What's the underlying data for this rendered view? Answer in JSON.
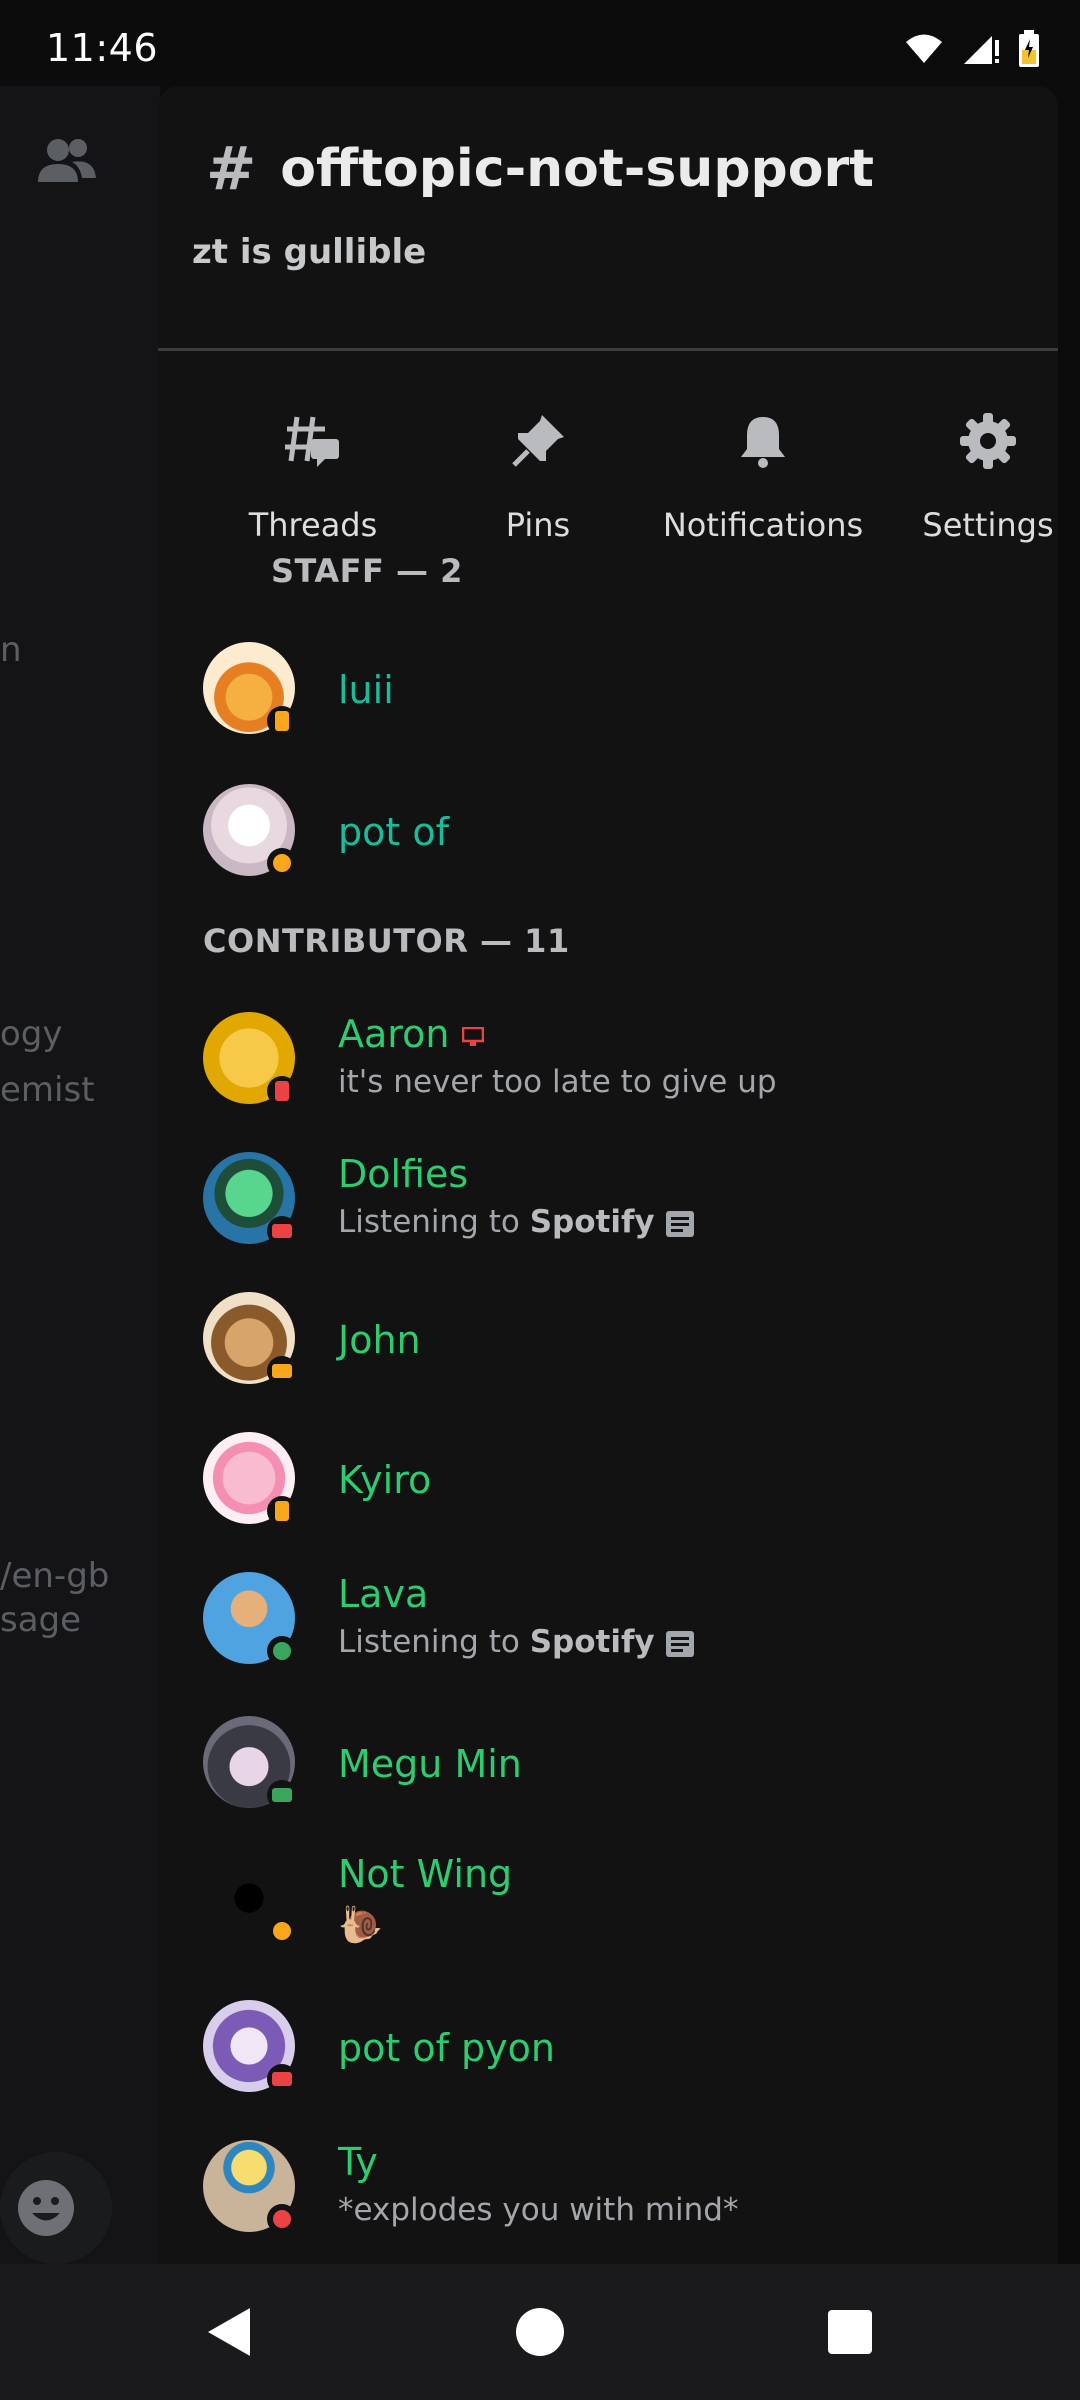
{
  "status_bar": {
    "time": "11:46"
  },
  "background_chat": {
    "fragments": [
      "n",
      "ogy",
      "emist",
      "/en-gb",
      "sage"
    ]
  },
  "channel": {
    "name": "offtopic-not-support",
    "topic": "zt is gullible"
  },
  "actions": [
    {
      "label": "Threads",
      "icon": "threads-icon"
    },
    {
      "label": "Pins",
      "icon": "pin-icon"
    },
    {
      "label": "Notifications",
      "icon": "bell-icon"
    },
    {
      "label": "Settings",
      "icon": "gear-icon"
    }
  ],
  "sections": {
    "staff": "STAFF — 2",
    "contributor": "CONTRIBUTOR — 11"
  },
  "staff_members": [
    {
      "name": "luii",
      "status": "idle-mobile"
    },
    {
      "name": "pot of",
      "status": "idle-web"
    }
  ],
  "contributor_members": [
    {
      "name": "Aaron",
      "sub": "it's never too late to give up",
      "status": "dnd-mobile",
      "name_icon": "desktop-icon"
    },
    {
      "name": "Dolfies",
      "sub_prefix": "Listening to ",
      "sub_bold": "Spotify",
      "status": "dnd-desktop"
    },
    {
      "name": "John",
      "status": "idle-desktop"
    },
    {
      "name": "Kyiro",
      "status": "idle-mobile"
    },
    {
      "name": "Lava",
      "sub_prefix": "Listening to ",
      "sub_bold": "Spotify",
      "status": "online-web"
    },
    {
      "name": "Megu Min",
      "status": "online-desktop"
    },
    {
      "name": "Not Wing",
      "sub": "🐌",
      "status": "idle-web"
    },
    {
      "name": "pot of pyon",
      "status": "dnd-desktop"
    },
    {
      "name": "Ty",
      "sub": "*explodes you with mind*",
      "status": "dnd-web"
    }
  ],
  "colors": {
    "staff_name": "#1abc9c",
    "contributor_name": "#2ecc71",
    "idle": "#faa61a",
    "dnd": "#ed4245",
    "online": "#3ba55d"
  }
}
